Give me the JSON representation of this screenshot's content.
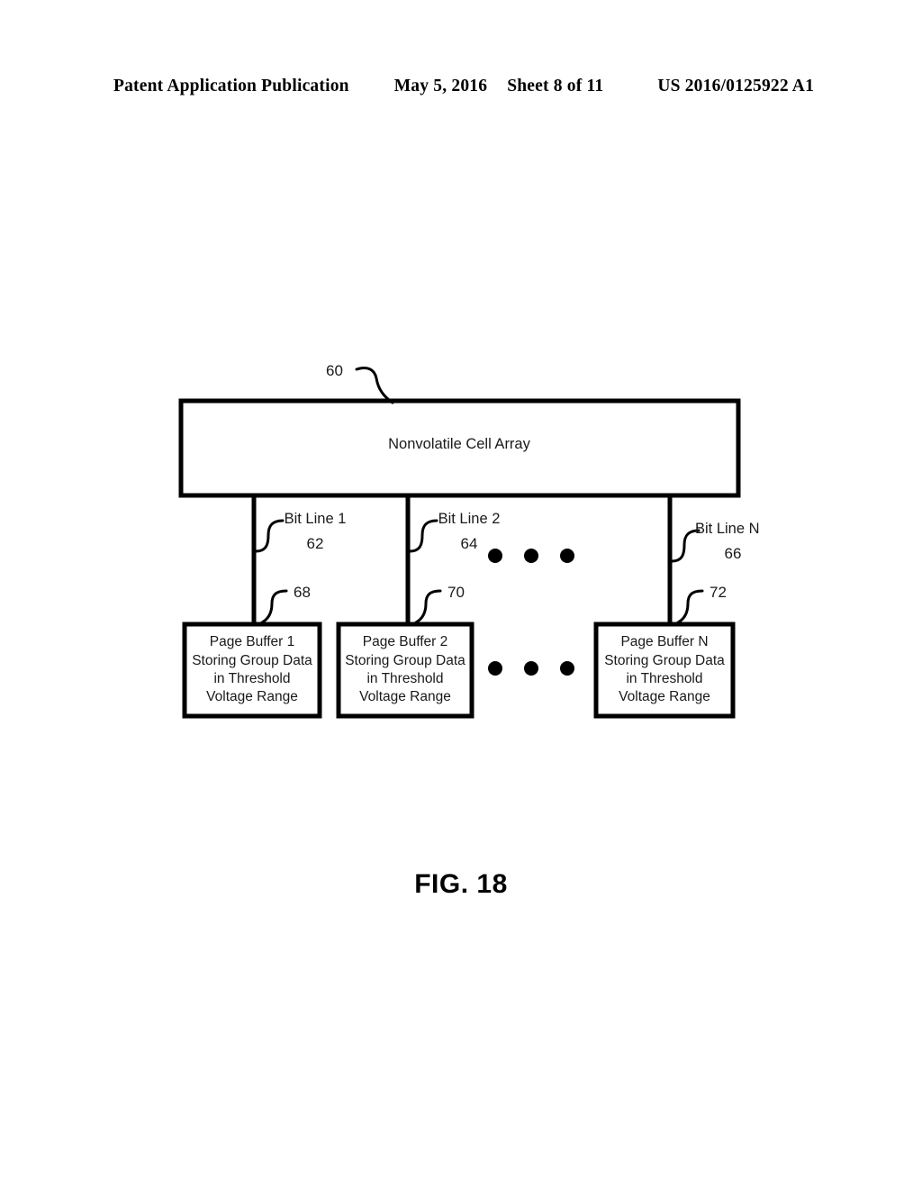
{
  "header": {
    "publication": "Patent Application Publication",
    "date": "May 5, 2016",
    "sheet": "Sheet 8 of 11",
    "patent_number": "US 2016/0125922 A1"
  },
  "figure": {
    "caption": "FIG. 18",
    "array_block": {
      "label": "Nonvolatile Cell Array",
      "ref": "60"
    },
    "bit_lines": [
      {
        "label": "Bit Line 1",
        "ref": "62"
      },
      {
        "label": "Bit Line 2",
        "ref": "64"
      },
      {
        "label": "Bit Line N",
        "ref": "66"
      }
    ],
    "page_buffers": [
      {
        "label": "Page Buffer 1 Storing Group Data in Threshold Voltage Range",
        "ref": "68"
      },
      {
        "label": "Page Buffer 2 Storing Group Data in Threshold Voltage Range",
        "ref": "70"
      },
      {
        "label": "Page Buffer N Storing Group Data in Threshold Voltage Range",
        "ref": "72"
      }
    ],
    "ellipsis_upper": "• • •",
    "ellipsis_lower": "• • •"
  },
  "colors": {
    "ink": "#000000",
    "text": "#1a1a1a",
    "background": "#ffffff"
  }
}
